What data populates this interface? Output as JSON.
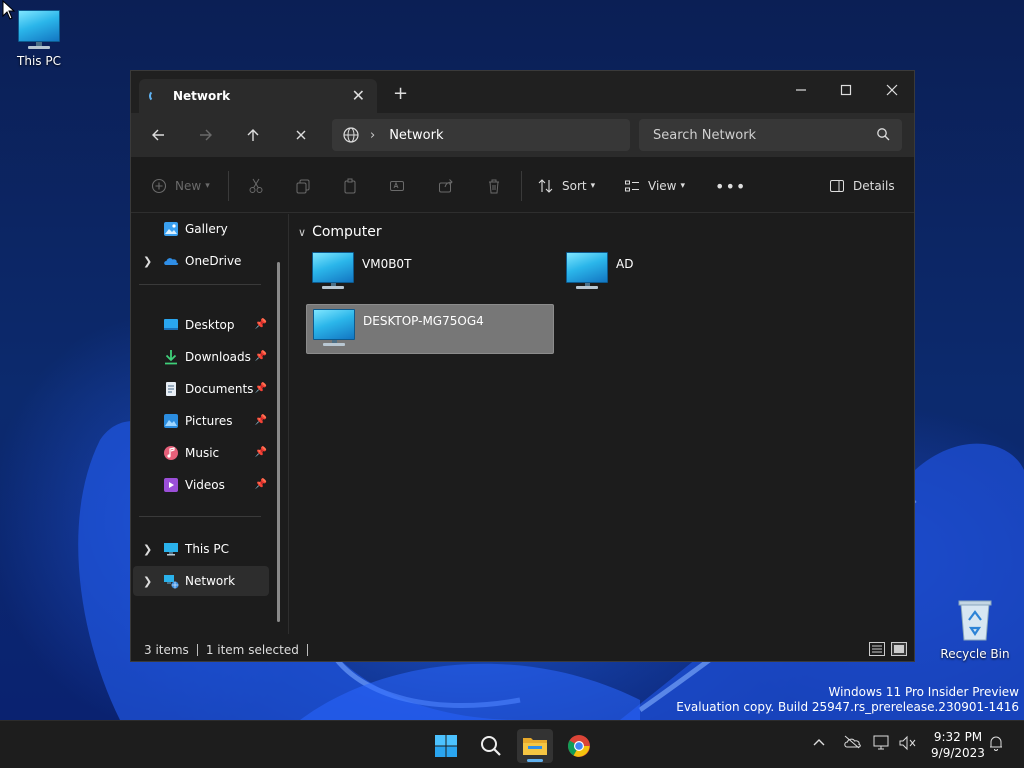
{
  "desktop": {
    "icons": [
      {
        "label": "This PC"
      },
      {
        "label": "Recycle Bin"
      }
    ],
    "watermark": {
      "line1": "Windows 11 Pro Insider Preview",
      "line2": "Evaluation copy. Build 25947.rs_prerelease.230901-1416"
    }
  },
  "window": {
    "tab_title": "Network",
    "new_tab_symbol": "+",
    "address": {
      "location": "Network"
    },
    "search": {
      "placeholder": "Search Network"
    },
    "toolbar": {
      "new_label": "New",
      "sort_label": "Sort",
      "view_label": "View",
      "details_label": "Details"
    },
    "nav": {
      "items": [
        {
          "label": "Gallery"
        },
        {
          "label": "OneDrive"
        },
        {
          "label": "Desktop"
        },
        {
          "label": "Downloads"
        },
        {
          "label": "Documents"
        },
        {
          "label": "Pictures"
        },
        {
          "label": "Music"
        },
        {
          "label": "Videos"
        },
        {
          "label": "This PC"
        },
        {
          "label": "Network"
        }
      ]
    },
    "content": {
      "group_label": "Computer",
      "computers": [
        {
          "name": "VM0B0T"
        },
        {
          "name": "AD"
        },
        {
          "name": "DESKTOP-MG75OG4",
          "selected": true
        }
      ]
    },
    "status": {
      "items_count": "3 items",
      "selected": "1 item selected"
    }
  },
  "taskbar": {
    "clock": {
      "time": "9:32 PM",
      "date": "9/9/2023"
    }
  },
  "colors": {
    "accent": "#60b0ee",
    "window_bg": "#1c1c1c",
    "selection": "#777777"
  }
}
